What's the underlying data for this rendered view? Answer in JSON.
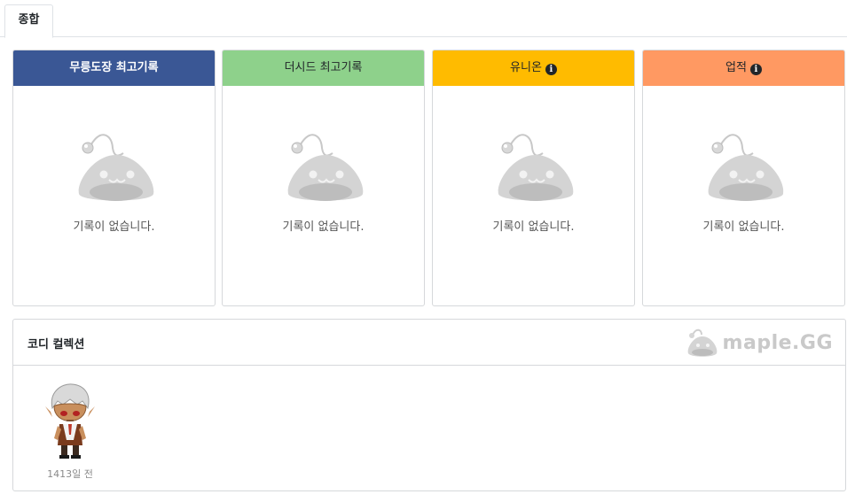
{
  "tabs": [
    {
      "label": "종합",
      "active": true
    }
  ],
  "cards": [
    {
      "title": "무릉도장 최고기록",
      "has_info": false,
      "empty_text": "기록이 없습니다.",
      "header_color": "#3a5795"
    },
    {
      "title": "더시드 최고기록",
      "has_info": false,
      "empty_text": "기록이 없습니다.",
      "header_color": "#8ed18b"
    },
    {
      "title": "유니온",
      "has_info": true,
      "empty_text": "기록이 없습니다.",
      "header_color": "#ffbb00"
    },
    {
      "title": "업적",
      "has_info": true,
      "empty_text": "기록이 없습니다.",
      "header_color": "#ff9962"
    }
  ],
  "coordi": {
    "title": "코디 컬렉션",
    "brand": "maple.GG",
    "items": [
      {
        "date": "1413일 전"
      }
    ]
  },
  "icons": {
    "info": "info-icon",
    "empty": "slime-icon",
    "brand": "maplegg-logo-icon"
  }
}
